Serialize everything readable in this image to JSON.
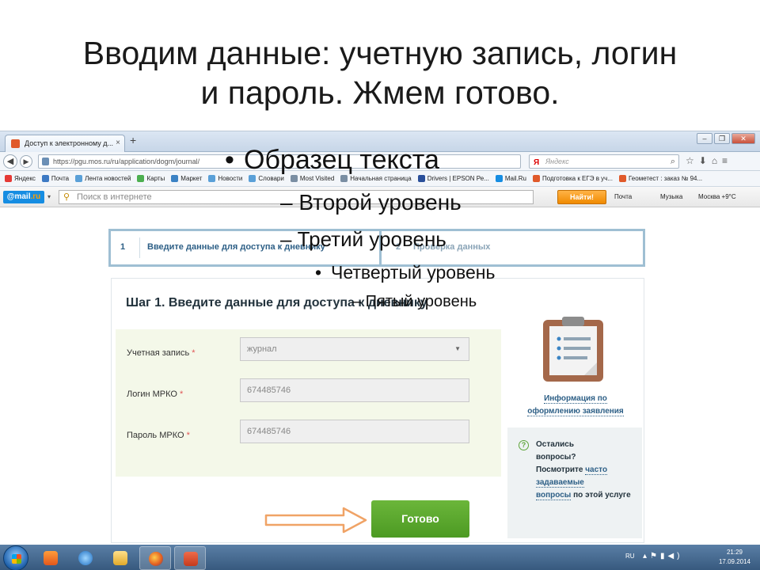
{
  "slide": {
    "title_line1": "Вводим данные: учетную запись, логин",
    "title_line2": "и пароль. Жмем готово."
  },
  "placeholder": {
    "level1": "Образец текста",
    "level2": "– Второй уровень",
    "level3": "– Третий уровень",
    "level4": "Четвертый уровень",
    "level5": "– Пятый уровень"
  },
  "browser": {
    "tab_title": "Доступ к электронному д...",
    "tab_close": "×",
    "new_tab": "+",
    "url": "https://pgu.mos.ru/ru/application/dogm/journal/",
    "search_placeholder": "Яндекс",
    "search_engine_mark": "Я",
    "bookmarks": [
      {
        "label": "Яндекс",
        "color": "#e53935"
      },
      {
        "label": "Почта",
        "color": "#3d7ac4"
      },
      {
        "label": "Лента новостей",
        "color": "#5aa0d8"
      },
      {
        "label": "Карты",
        "color": "#4caf50"
      },
      {
        "label": "Маркет",
        "color": "#3b82c4"
      },
      {
        "label": "Новости",
        "color": "#5aa0d8"
      },
      {
        "label": "Словари",
        "color": "#5aa0d8"
      },
      {
        "label": "Most Visited",
        "color": "#7a8ea3"
      },
      {
        "label": "Начальная страница",
        "color": "#7a8ea3"
      },
      {
        "label": "Drivers | EPSON Ре...",
        "color": "#2a4f9a"
      },
      {
        "label": "Mail.Ru",
        "color": "#168de2"
      },
      {
        "label": "Подготовка к ЕГЭ в уч...",
        "color": "#e05a2b"
      },
      {
        "label": "Геометест : заказ № 94...",
        "color": "#e05a2b"
      }
    ]
  },
  "mailbar": {
    "logo_prefix": "@mail",
    "logo_suffix": ".ru",
    "search_placeholder": "Поиск в интернете",
    "search_button": "Найти!",
    "items": [
      {
        "label": "Почта"
      },
      {
        "label": "Музыка"
      },
      {
        "label": "Москва +9°C"
      }
    ]
  },
  "steps": {
    "step1_num": "1",
    "step1_label": "Введите данные для доступа к дневнику",
    "step2_num": "2",
    "step2_label": "Проверка данных"
  },
  "form": {
    "heading": "Шаг 1. Введите данные для доступа к дневнику",
    "account_label": "Учетная запись",
    "account_value": "журнал",
    "login_label": "Логин МРКО",
    "login_value": "674485746",
    "password_label": "Пароль МРКО",
    "password_value": "674485746",
    "required_mark": "*",
    "submit": "Готово"
  },
  "sidebar": {
    "info_link_line1": "Информация по",
    "info_link_line2": "оформлению заявления",
    "q_mark": "?",
    "q_line1": "Остались",
    "q_line2": "вопросы?",
    "q_line3": "Посмотрите",
    "q_link1": "часто",
    "q_link2": "задаваемые",
    "q_link3": "вопросы",
    "q_tail": "по этой услуге"
  },
  "taskbar": {
    "lang": "RU",
    "time": "21:29",
    "date": "17.09.2014"
  },
  "colors": {
    "accent_blue": "#2d5f86",
    "button_green": "#5aa62e",
    "form_bg": "#f4f8e9",
    "arrow_orange": "#f0a366"
  }
}
